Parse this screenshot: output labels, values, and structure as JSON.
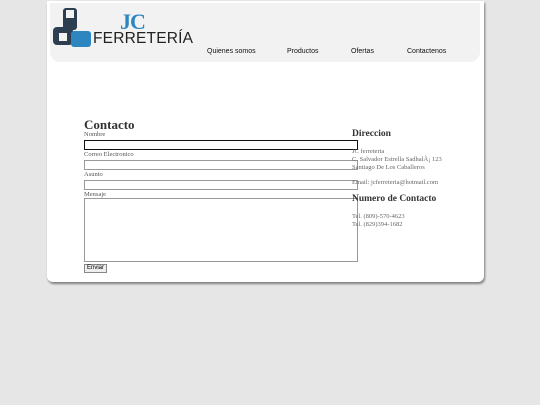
{
  "brand": {
    "short": "JC",
    "name": "FERRETERÍA"
  },
  "nav": [
    "Quienes somos",
    "Productos",
    "Ofertas",
    "Contactenos"
  ],
  "form": {
    "title": "Contacto",
    "labels": [
      "Nombre",
      "Correo Electronico",
      "Asunto",
      "Mensaje"
    ],
    "submit": "Enviar"
  },
  "address": {
    "heading": "Direccion",
    "lines": [
      "JC ferreteria",
      "C. Salvador Estrella SadhalÃ¡ 123",
      "Santiago De Los Caballeros",
      "Email: jcferreteria@hotmail.com"
    ]
  },
  "phones": {
    "heading": "Numero de Contacto",
    "lines": [
      "Tel. (809)-570-4623",
      "Tel. (829)394-1682"
    ]
  },
  "colors": {
    "accent": "#2e86c1",
    "logo_dark": "#2c3e50"
  }
}
